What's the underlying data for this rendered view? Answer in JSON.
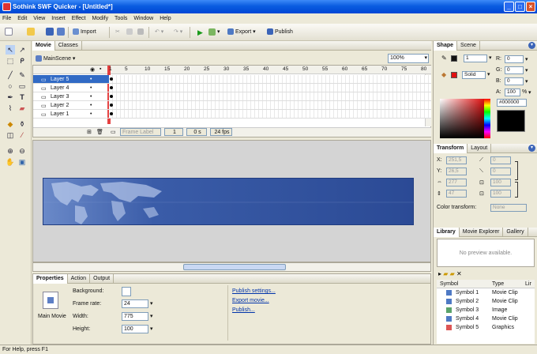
{
  "window": {
    "title": "Sothink SWF Quicker - [Untitled*]"
  },
  "menu": [
    "File",
    "Edit",
    "View",
    "Insert",
    "Effect",
    "Modify",
    "Tools",
    "Window",
    "Help"
  ],
  "toolbar": {
    "import_label": "Import",
    "export_label": "Export",
    "publish_label": "Publish"
  },
  "center_tabs": [
    "Movie",
    "Classes"
  ],
  "scene": {
    "name": "MainScene",
    "zoom": "100%"
  },
  "timeline": {
    "ruler": [
      "1",
      "5",
      "10",
      "15",
      "20",
      "25",
      "30",
      "35",
      "40",
      "45",
      "50",
      "55",
      "60",
      "65",
      "70",
      "75",
      "80"
    ],
    "layers": [
      "Layer 5",
      "Layer 4",
      "Layer 3",
      "Layer 2",
      "Layer 1"
    ],
    "frame_label_placeholder": "Frame Label",
    "current_frame": "1",
    "time": "0 s",
    "fps": "24 fps"
  },
  "properties": {
    "tabs": [
      "Properties",
      "Action",
      "Output"
    ],
    "object_name": "Main Movie",
    "background_label": "Background:",
    "frame_rate_label": "Frame rate:",
    "frame_rate_value": "24",
    "width_label": "Width:",
    "width_value": "775",
    "height_label": "Height:",
    "height_value": "100",
    "links": [
      "Publish settings...",
      "Export movie...",
      "Publish..."
    ]
  },
  "shape_panel": {
    "tabs": [
      "Shape",
      "Scene"
    ],
    "line_width": "1",
    "fill_type": "Solid",
    "r_label": "R:",
    "g_label": "G:",
    "b_label": "B:",
    "a_label": "A:",
    "r_value": "0",
    "g_value": "0",
    "b_value": "0",
    "a_value": "100",
    "percent": "%",
    "hex": "#000000"
  },
  "transform_panel": {
    "tabs": [
      "Transform",
      "Layout"
    ],
    "x_label": "X:",
    "y_label": "Y:",
    "x_value": "251,5",
    "y_value": "26,5",
    "w_value": "277",
    "h_value": "47",
    "skew1": "0",
    "skew2": "0",
    "scale_w": "100",
    "scale_h": "100",
    "color_transform_label": "Color transform:",
    "color_transform_value": "None"
  },
  "library_panel": {
    "tabs": [
      "Library",
      "Movie Explorer",
      "Gallery"
    ],
    "preview_text": "No preview available.",
    "col_symbol": "Symbol",
    "col_type": "Type",
    "col_link": "Lir",
    "items": [
      {
        "name": "Symbol 1",
        "type": "Movie Clip"
      },
      {
        "name": "Symbol 2",
        "type": "Movie Clip"
      },
      {
        "name": "Symbol 3",
        "type": "Image"
      },
      {
        "name": "Symbol 4",
        "type": "Movie Clip"
      },
      {
        "name": "Symbol 5",
        "type": "Graphics"
      }
    ]
  },
  "status": {
    "text": "For Help, press F1"
  },
  "colors": {
    "titlebar": "#0a5ce0",
    "selection": "#316ac5",
    "banner": "#2b4a95",
    "playhead": "#e02020"
  }
}
